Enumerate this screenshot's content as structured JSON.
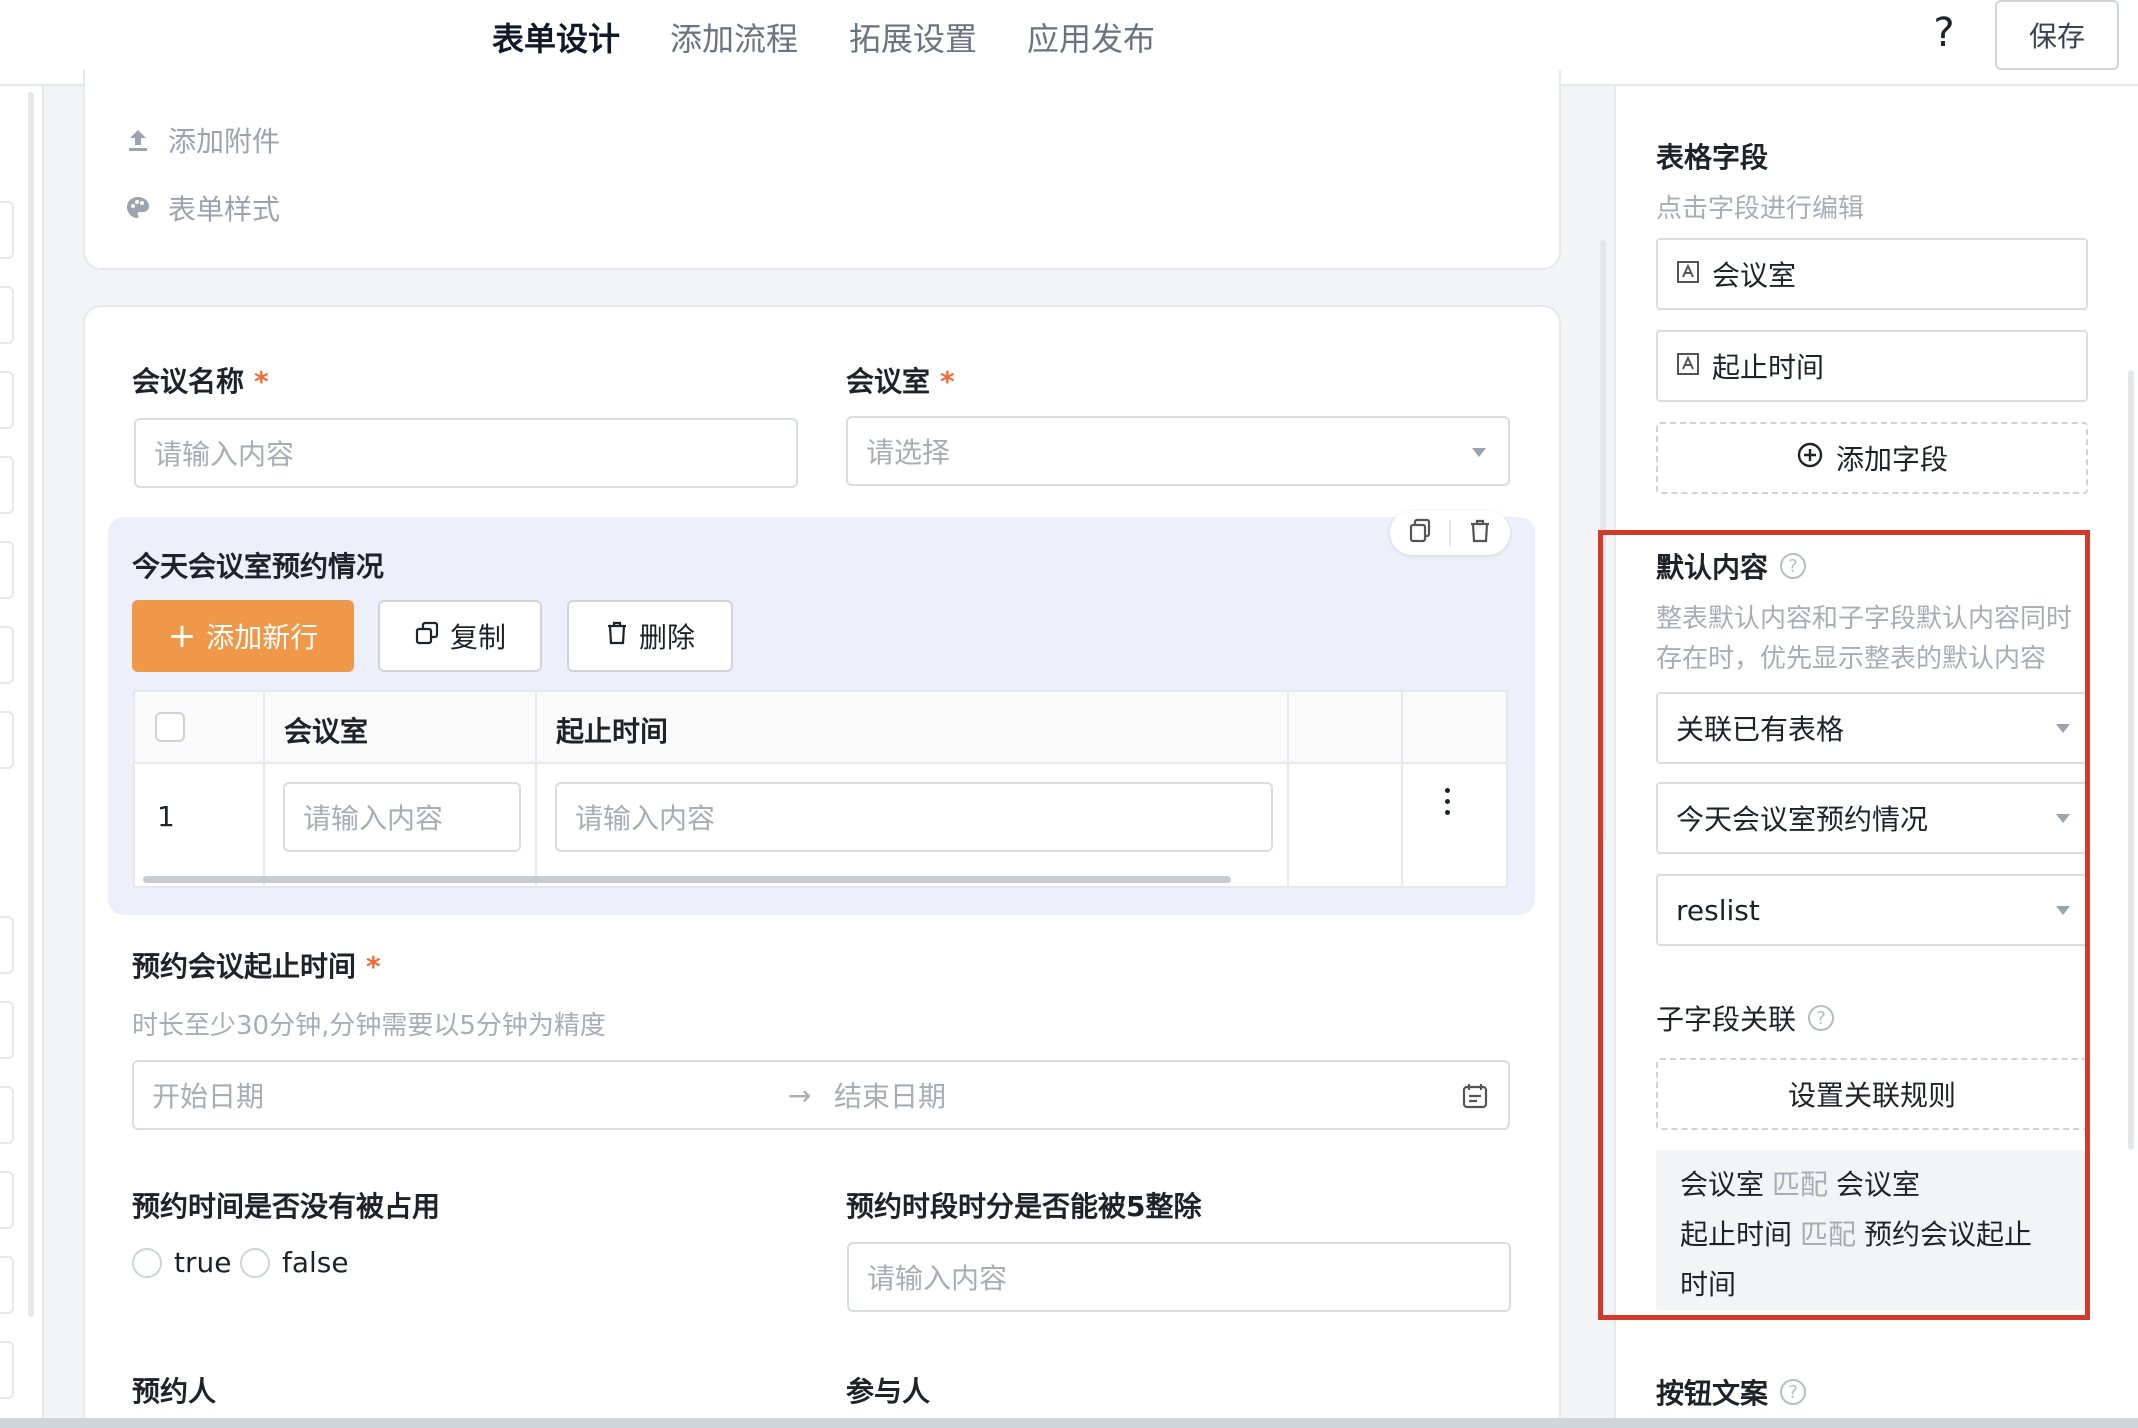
{
  "tabs": [
    {
      "label": "表单设计",
      "active": true
    },
    {
      "label": "添加流程",
      "active": false
    },
    {
      "label": "拓展设置",
      "active": false
    },
    {
      "label": "应用发布",
      "active": false
    }
  ],
  "header": {
    "help": "?",
    "save": "保存"
  },
  "toolbox": {
    "attach": "添加附件",
    "style": "表单样式"
  },
  "form": {
    "meeting_name": {
      "label": "会议名称",
      "required": "*",
      "placeholder": "请输入内容"
    },
    "room": {
      "label": "会议室",
      "required": "*",
      "placeholder": "请选择"
    },
    "subtable": {
      "title": "今天会议室预约情况",
      "add_row": "添加新行",
      "copy": "复制",
      "delete": "删除",
      "columns": [
        "会议室",
        "起止时间"
      ],
      "rows": [
        {
          "index": "1",
          "room_placeholder": "请输入内容",
          "time_placeholder": "请输入内容"
        }
      ]
    },
    "booking_time": {
      "label": "预约会议起止时间",
      "required": "*",
      "hint": "时长至少30分钟,分钟需要以5分钟为精度",
      "start_placeholder": "开始日期",
      "arrow": "→",
      "end_placeholder": "结束日期"
    },
    "not_occupied": {
      "label": "预约时间是否没有被占用",
      "options": [
        "true",
        "false"
      ]
    },
    "divisible": {
      "label": "预约时段时分是否能被5整除",
      "placeholder": "请输入内容"
    },
    "booker": {
      "label": "预约人"
    },
    "participants": {
      "label": "参与人"
    }
  },
  "right_panel": {
    "table_fields": {
      "title": "表格字段",
      "subtitle": "点击字段进行编辑",
      "fields": [
        "会议室",
        "起止时间"
      ],
      "add_field": "添加字段"
    },
    "default_content": {
      "title": "默认内容",
      "desc_line1": "整表默认内容和子字段默认内容同时",
      "desc_line2": "存在时，优先显示整表的默认内容",
      "selects": [
        "关联已有表格",
        "今天会议室预约情况",
        "reslist"
      ]
    },
    "child_link": {
      "title": "子字段关联",
      "set_rule": "设置关联规则",
      "rules": [
        {
          "left": "会议室",
          "match": "匹配",
          "right": "会议室"
        },
        {
          "left": "起止时间",
          "match": "匹配",
          "right": "预约会议起止",
          "right_cont": "时间"
        }
      ]
    },
    "button_text": {
      "title": "按钮文案"
    }
  },
  "colors": {
    "accent": "#f0984a",
    "highlight": "#d33a2c",
    "required": "#ef6b3a"
  }
}
